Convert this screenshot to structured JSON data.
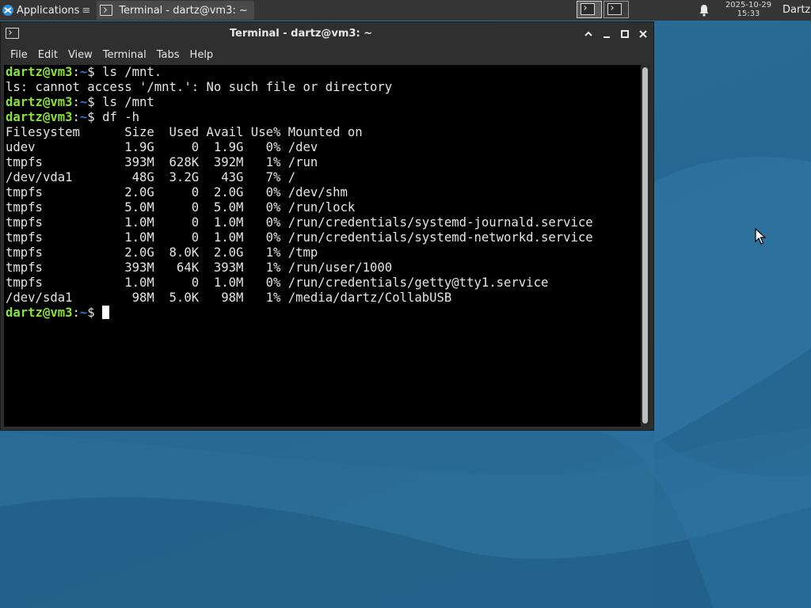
{
  "panel": {
    "applications_label": "Applications",
    "applications_suffix": "≡",
    "taskbar_window_title": "Terminal - dartz@vm3: ~",
    "clock_date": "2025-10-29",
    "clock_time": "15:33",
    "user_label": "Dartz"
  },
  "window": {
    "title": "Terminal - dartz@vm3: ~",
    "menu": [
      "File",
      "Edit",
      "View",
      "Terminal",
      "Tabs",
      "Help"
    ]
  },
  "terminal": {
    "prompt_user": "dartz@vm3",
    "prompt_path": "~",
    "lines": [
      {
        "type": "prompt",
        "cmd": "ls /mnt."
      },
      {
        "type": "output",
        "text": "ls: cannot access '/mnt.': No such file or directory"
      },
      {
        "type": "prompt",
        "cmd": "ls /mnt"
      },
      {
        "type": "prompt",
        "cmd": "df -h"
      },
      {
        "type": "output",
        "text": "Filesystem      Size  Used Avail Use% Mounted on"
      },
      {
        "type": "output",
        "text": "udev            1.9G     0  1.9G   0% /dev"
      },
      {
        "type": "output",
        "text": "tmpfs           393M  628K  392M   1% /run"
      },
      {
        "type": "output",
        "text": "/dev/vda1        48G  3.2G   43G   7% /"
      },
      {
        "type": "output",
        "text": "tmpfs           2.0G     0  2.0G   0% /dev/shm"
      },
      {
        "type": "output",
        "text": "tmpfs           5.0M     0  5.0M   0% /run/lock"
      },
      {
        "type": "output",
        "text": "tmpfs           1.0M     0  1.0M   0% /run/credentials/systemd-journald.service"
      },
      {
        "type": "output",
        "text": "tmpfs           1.0M     0  1.0M   0% /run/credentials/systemd-networkd.service"
      },
      {
        "type": "output",
        "text": "tmpfs           2.0G  8.0K  2.0G   1% /tmp"
      },
      {
        "type": "output",
        "text": "tmpfs           393M   64K  393M   1% /run/user/1000"
      },
      {
        "type": "output",
        "text": "tmpfs           1.0M     0  1.0M   0% /run/credentials/getty@tty1.service"
      },
      {
        "type": "output",
        "text": "/dev/sda1        98M  5.0K   98M   1% /media/dartz/CollabUSB"
      },
      {
        "type": "prompt_cursor",
        "cmd": ""
      }
    ]
  },
  "colors": {
    "prompt_user": "#8ae234",
    "prompt_path": "#3b6fd6",
    "terminal_bg": "#000000",
    "panel_bg": "#353535"
  }
}
